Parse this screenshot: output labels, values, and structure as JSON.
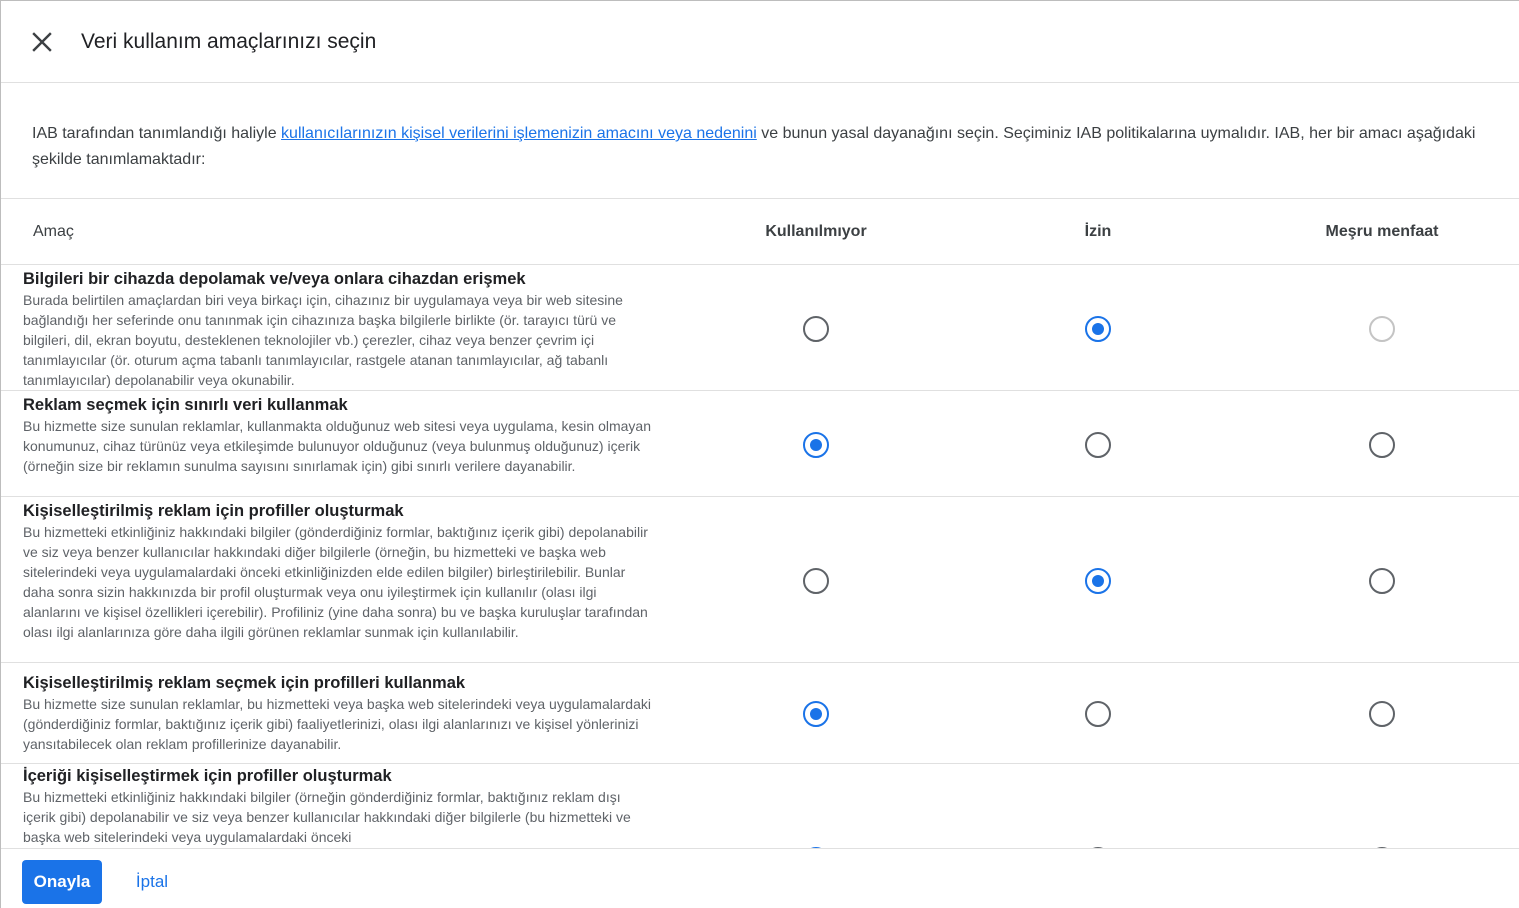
{
  "dialog": {
    "title": "Veri kullanım amaçlarınızı seçin",
    "close_icon": "close-icon"
  },
  "intro": {
    "before_link": "IAB tarafından tanımlandığı haliyle ",
    "link_text": "kullanıcılarınızın kişisel verilerini işlemenizin amacını veya nedenini",
    "after_link": " ve bunun yasal dayanağını seçin. Seçiminiz IAB politikalarına uymalıdır. IAB, her bir amacı aşağıdaki şekilde tanımlamaktadır:"
  },
  "table": {
    "headers": {
      "purpose": "Amaç",
      "not_used": "Kullanılmıyor",
      "consent": "İzin",
      "legitimate_interest": "Meşru menfaat"
    },
    "rows": [
      {
        "title": "Bilgileri bir cihazda depolamak ve/veya onlara cihazdan erişmek",
        "description": "Burada belirtilen amaçlardan biri veya birkaçı için, cihazınız bir uygulamaya veya bir web sitesine bağlandığı her seferinde onu tanınmak için cihazınıza başka bilgilerle birlikte (ör. tarayıcı türü ve bilgileri, dil, ekran boyutu, desteklenen teknolojiler vb.) çerezler, cihaz veya benzer çevrim içi tanımlayıcılar (ör. oturum açma tabanlı tanımlayıcılar, rastgele atanan tanımlayıcılar, ağ tabanlı tanımlayıcılar) depolanabilir veya okunabilir.",
        "selected": "consent",
        "legitimate_interest_disabled": true
      },
      {
        "title": "Reklam seçmek için sınırlı veri kullanmak",
        "description": "Bu hizmette size sunulan reklamlar, kullanmakta olduğunuz web sitesi veya uygulama, kesin olmayan konumunuz, cihaz türünüz veya etkileşimde bulunuyor olduğunuz (veya bulunmuş olduğunuz) içerik (örneğin size bir reklamın sunulma sayısını sınırlamak için) gibi sınırlı verilere dayanabilir.",
        "selected": "not_used",
        "legitimate_interest_disabled": false
      },
      {
        "title": "Kişiselleştirilmiş reklam için profiller oluşturmak",
        "description": "Bu hizmetteki etkinliğiniz hakkındaki bilgiler (gönderdiğiniz formlar, baktığınız içerik gibi) depolanabilir ve siz veya benzer kullanıcılar hakkındaki diğer bilgilerle (örneğin, bu hizmetteki ve başka web sitelerindeki veya uygulamalardaki önceki etkinliğinizden elde edilen bilgiler) birleştirilebilir. Bunlar daha sonra sizin hakkınızda bir profil oluşturmak veya onu iyileştirmek için kullanılır (olası ilgi alanlarını ve kişisel özellikleri içerebilir). Profiliniz (yine daha sonra) bu ve başka kuruluşlar tarafından olası ilgi alanlarınıza göre daha ilgili görünen reklamlar sunmak için kullanılabilir.",
        "selected": "consent",
        "legitimate_interest_disabled": false
      },
      {
        "title": "Kişiselleştirilmiş reklam seçmek için profilleri kullanmak",
        "description": "Bu hizmette size sunulan reklamlar, bu hizmetteki veya başka web sitelerindeki veya uygulamalardaki (gönderdiğiniz formlar, baktığınız içerik gibi) faaliyetlerinizi, olası ilgi alanlarınızı ve kişisel yönlerinizi yansıtabilecek olan reklam profillerinize dayanabilir.",
        "selected": "not_used",
        "legitimate_interest_disabled": false
      },
      {
        "title": "İçeriği kişiselleştirmek için profiller oluşturmak",
        "description": "Bu hizmetteki etkinliğiniz hakkındaki bilgiler (örneğin gönderdiğiniz formlar, baktığınız reklam dışı içerik gibi) depolanabilir ve siz veya benzer kullanıcılar hakkındaki diğer bilgilerle (bu hizmetteki ve başka web sitelerindeki veya uygulamalardaki önceki",
        "selected": "not_used",
        "legitimate_interest_disabled": false
      }
    ]
  },
  "footer": {
    "confirm_label": "Onayla",
    "cancel_label": "İptal"
  },
  "colors": {
    "accent": "#1a73e8",
    "radio_border": "#5f6368",
    "radio_disabled": "#c4c4c4"
  }
}
